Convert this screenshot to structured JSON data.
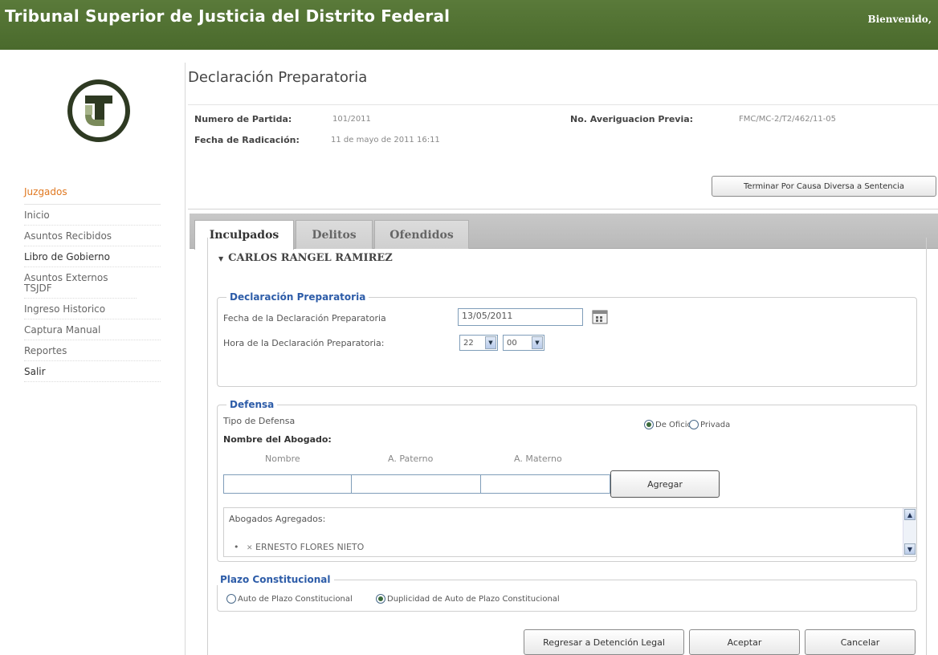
{
  "header": {
    "title": "Tribunal Superior de Justicia del Distrito Federal",
    "welcome": "Bienvenido,"
  },
  "sidebar": {
    "heading": "Juzgados",
    "items": [
      {
        "label": "Inicio"
      },
      {
        "label": "Asuntos Recibidos"
      },
      {
        "label": "Libro de Gobierno"
      },
      {
        "label": "Asuntos Externos TSJDF"
      },
      {
        "label": "Ingreso Historico"
      },
      {
        "label": "Captura Manual"
      },
      {
        "label": "Reportes"
      },
      {
        "label": "Salir"
      }
    ]
  },
  "page": {
    "title": "Declaración Preparatoria",
    "numero_partida_label": "Numero de Partida:",
    "numero_partida_value": "101/2011",
    "averiguacion_label": "No. Averiguacion Previa:",
    "averiguacion_value": "FMC/MC-2/T2/462/11-05",
    "fecha_radicacion_label": "Fecha de Radicación:",
    "fecha_radicacion_value": "11 de mayo de 2011 16:11",
    "terminar_button": "Terminar Por Causa Diversa a Sentencia"
  },
  "tabs": [
    {
      "label": "Inculpados",
      "active": true
    },
    {
      "label": "Delitos",
      "active": false
    },
    {
      "label": "Ofendidos",
      "active": false
    }
  ],
  "inculpado": {
    "name": "CARLOS RANGEL RAMIREZ",
    "collapse_glyph": "▼"
  },
  "declaracion": {
    "legend": "Declaración Preparatoria",
    "fecha_label": "Fecha de la Declaración Preparatoria",
    "fecha_value": "13/05/2011",
    "hora_label": "Hora de la Declaración Preparatoria:",
    "hora_value": "22",
    "minuto_value": "00"
  },
  "defensa": {
    "legend": "Defensa",
    "tipo_label": "Tipo de Defensa",
    "oficio_label": "De Oficio",
    "privada_label": "Privada",
    "selected": "De Oficio",
    "abogado_label": "Nombre del Abogado:",
    "col_nombre": "Nombre",
    "col_paterno": "A. Paterno",
    "col_materno": "A. Materno",
    "agregar_button": "Agregar",
    "agregados_label": "Abogados Agregados:",
    "agregados": [
      "ERNESTO  FLORES  NIETO"
    ]
  },
  "plazo": {
    "legend": "Plazo Constitucional",
    "option1": "Auto de Plazo Constitucional",
    "option2": "Duplicidad de Auto de Plazo Constitucional",
    "selected": "Duplicidad de Auto de Plazo Constitucional"
  },
  "footer_buttons": {
    "regresar": "Regresar a Detención Legal",
    "aceptar": "Aceptar",
    "cancelar": "Cancelar"
  }
}
